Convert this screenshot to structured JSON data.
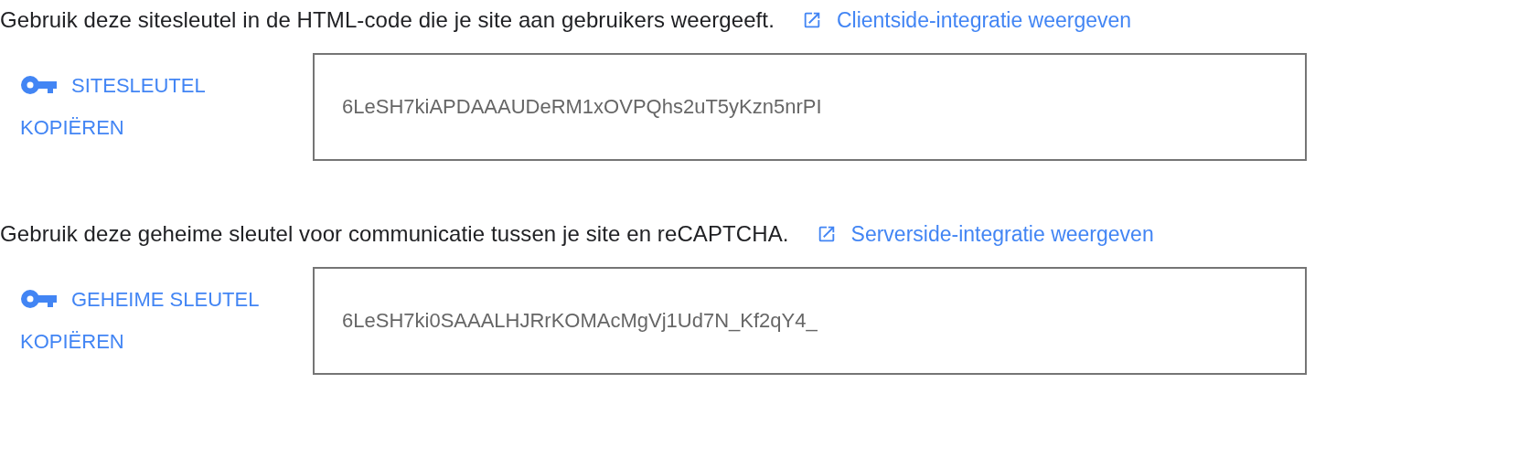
{
  "sections": [
    {
      "description": "Gebruik deze sitesleutel in de HTML-code die je site aan gebruikers weergeeft.",
      "link": "Clientside-integratie weergeven",
      "copy_button": "SITESLEUTEL KOPIËREN",
      "key_value": "6LeSH7kiAPDAAAUDeRM1xOVPQhs2uT5yKzn5nrPI"
    },
    {
      "description": "Gebruik deze geheime sleutel voor communicatie tussen je site en reCAPTCHA.",
      "link": "Serverside-integratie weergeven",
      "copy_button": "GEHEIME SLEUTEL KOPIËREN",
      "key_value": "6LeSH7ki0SAAALHJRrKOMAcMgVj1Ud7N_Kf2qY4_"
    }
  ]
}
